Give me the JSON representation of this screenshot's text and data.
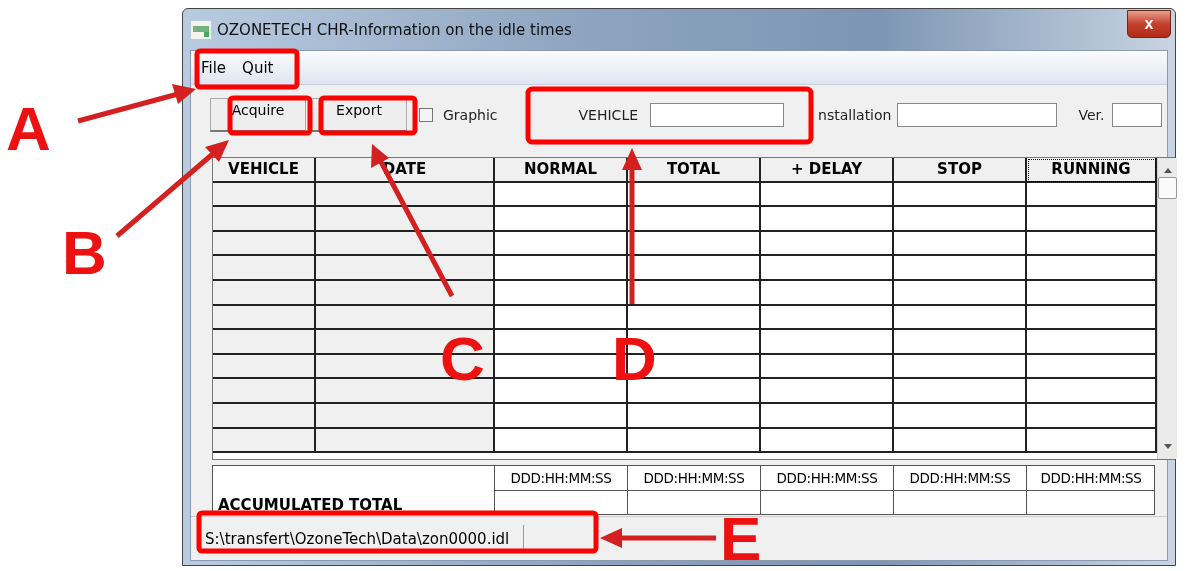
{
  "window": {
    "title": "OZONETECH CHR-Information on the idle times",
    "close": "x"
  },
  "menu": [
    "File",
    "Quit"
  ],
  "toolbar": {
    "buttons": [
      "Acquire",
      "Export"
    ],
    "graphic": {
      "label": "Graphic",
      "checked": false
    },
    "vehicle_label": "VEHICLE",
    "installation_label": "nstallation",
    "version_label": "Ver."
  },
  "table": {
    "columns": [
      "VEHICLE",
      "DATE",
      "NORMAL",
      "TOTAL",
      "+ DELAY",
      "STOP",
      "RUNNING"
    ]
  },
  "totals": {
    "label": "ACCUMULATED TOTAL",
    "units": [
      "DDD:HH:MM:SS",
      "DDD:HH:MM:SS",
      "DDD:HH:MM:SS",
      "DDD:HH:MM:SS",
      "DDD:HH:MM:SS"
    ]
  },
  "status_bar": {
    "path": "S:\\transfert\\OzoneTech\\Data\\zon0000.idl"
  },
  "callouts": [
    "A",
    "B",
    "C",
    "D",
    "E"
  ]
}
